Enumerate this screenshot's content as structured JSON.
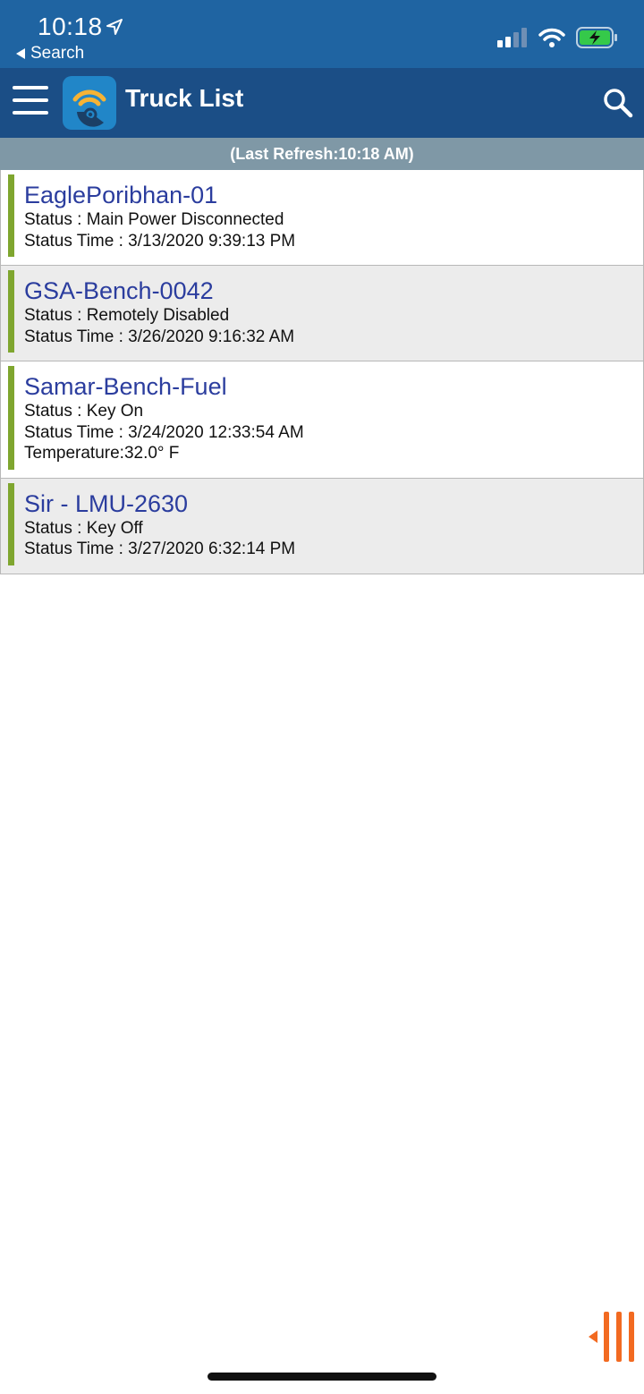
{
  "status_bar": {
    "time": "10:18",
    "back_label": "Search"
  },
  "header": {
    "title": "Truck List"
  },
  "refresh": {
    "text": "(Last Refresh:10:18 AM)"
  },
  "trucks": [
    {
      "name": "EaglePoribhan-01",
      "status": "Status : Main Power Disconnected",
      "status_time": "Status Time : 3/13/2020 9:39:13 PM"
    },
    {
      "name": "GSA-Bench-0042",
      "status": "Status : Remotely Disabled",
      "status_time": "Status Time : 3/26/2020 9:16:32 AM"
    },
    {
      "name": "Samar-Bench-Fuel",
      "status": "Status : Key On",
      "status_time": "Status Time : 3/24/2020 12:33:54 AM",
      "temperature": "Temperature:32.0° F"
    },
    {
      "name": "Sir - LMU-2630",
      "status": "Status : Key Off",
      "status_time": "Status Time : 3/27/2020 6:32:14 PM"
    }
  ],
  "colors": {
    "status_bar": "#1f64a2",
    "app_bar": "#1b4e86",
    "refresh_bar": "#7f98a6",
    "truck_name": "#2b3d9e",
    "status_indicator": "#7fa62f",
    "handle_accent": "#f26a21"
  },
  "icons": {
    "menu": "hamburger-menu-icon",
    "logo": "app-logo-icon",
    "search": "search-icon",
    "handle": "side-panel-handle-icon"
  }
}
